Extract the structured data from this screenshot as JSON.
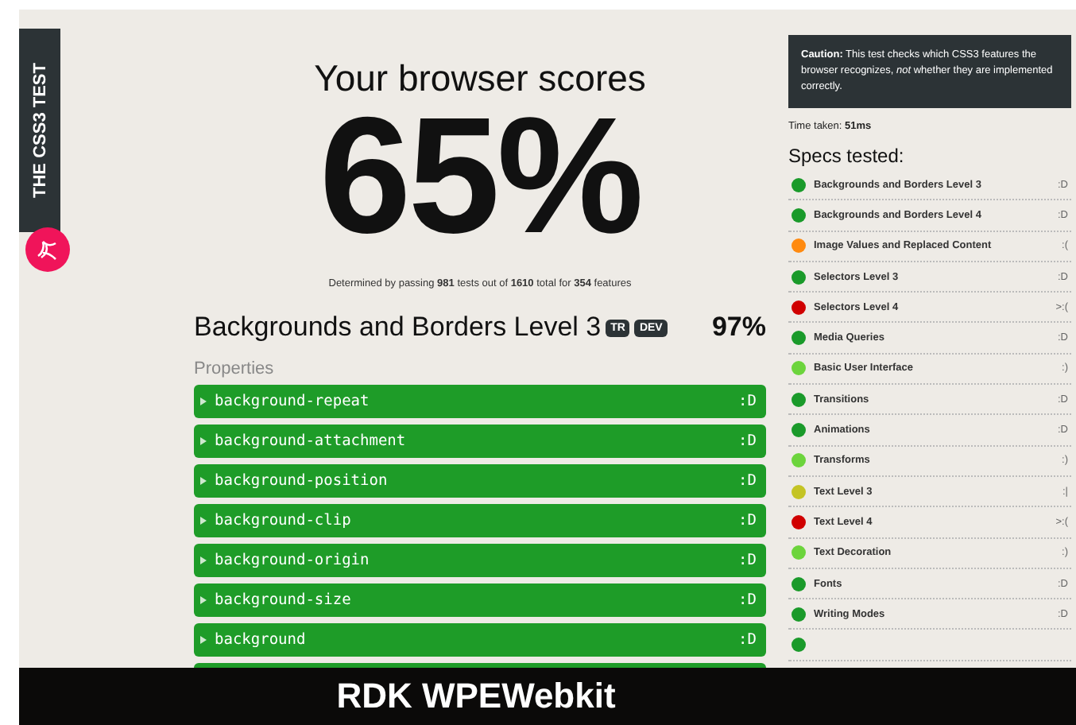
{
  "side_tab": {
    "label": "THE CSS3 TEST"
  },
  "score": {
    "heading": "Your browser scores",
    "value": "65%",
    "summary": "Determined by passing **981** tests out of **1610** total for **354** features"
  },
  "spec": {
    "title": "Backgrounds and Borders Level 3",
    "badges": [
      "TR",
      "DEV"
    ],
    "percent": "97%",
    "section": "Properties",
    "properties": [
      {
        "name": "background-repeat",
        "result": ":D",
        "color": "#1e9c28"
      },
      {
        "name": "background-attachment",
        "result": ":D",
        "color": "#1e9c28"
      },
      {
        "name": "background-position",
        "result": ":D",
        "color": "#1e9c28"
      },
      {
        "name": "background-clip",
        "result": ":D",
        "color": "#1e9c28"
      },
      {
        "name": "background-origin",
        "result": ":D",
        "color": "#1e9c28"
      },
      {
        "name": "background-size",
        "result": ":D",
        "color": "#1e9c28"
      },
      {
        "name": "background",
        "result": ":D",
        "color": "#1e9c28"
      }
    ]
  },
  "caution": {
    "text": "**Caution:** This test checks which CSS3 features the browser recognizes, *not* whether they are implemented correctly."
  },
  "time_taken": "Time taken: **51ms**",
  "specs_tested": {
    "title": "Specs tested:",
    "items": [
      {
        "name": "Backgrounds and Borders Level 3",
        "result": ":D",
        "color": "#1a9a2a"
      },
      {
        "name": "Backgrounds and Borders Level 4",
        "result": ":D",
        "color": "#1a9a2a"
      },
      {
        "name": "Image Values and Replaced Content",
        "result": ":(",
        "color": "#ff8a10"
      },
      {
        "name": "Selectors Level 3",
        "result": ":D",
        "color": "#1a9a2a"
      },
      {
        "name": "Selectors Level 4",
        "result": ">:(",
        "color": "#d00000"
      },
      {
        "name": "Media Queries",
        "result": ":D",
        "color": "#1a9a2a"
      },
      {
        "name": "Basic User Interface",
        "result": ":)",
        "color": "#6cd43c"
      },
      {
        "name": "Transitions",
        "result": ":D",
        "color": "#1a9a2a"
      },
      {
        "name": "Animations",
        "result": ":D",
        "color": "#1a9a2a"
      },
      {
        "name": "Transforms",
        "result": ":)",
        "color": "#6cd43c"
      },
      {
        "name": "Text Level 3",
        "result": ":|",
        "color": "#c4c424"
      },
      {
        "name": "Text Level 4",
        "result": ">:(",
        "color": "#d00000"
      },
      {
        "name": "Text Decoration",
        "result": ":)",
        "color": "#6cd43c"
      },
      {
        "name": "Fonts",
        "result": ":D",
        "color": "#1a9a2a"
      },
      {
        "name": "Writing Modes",
        "result": ":D",
        "color": "#1a9a2a"
      }
    ]
  },
  "caption": "RDK WPEWebkit"
}
